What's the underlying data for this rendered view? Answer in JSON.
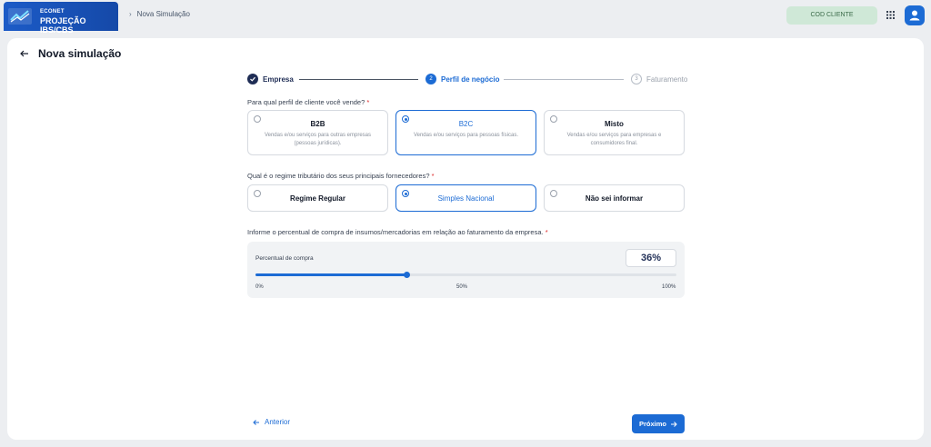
{
  "brand": {
    "subtitle": "ECONET",
    "title": "PROJEÇÃO IBS/CBS"
  },
  "breadcrumb": {
    "current": "Nova Simulação"
  },
  "header": {
    "cod_cliente_label": "COD CLIENTE"
  },
  "page": {
    "title": "Nova simulação"
  },
  "stepper": {
    "steps": [
      {
        "label": "Empresa",
        "number": "",
        "state": "done"
      },
      {
        "label": "Perfil de negócio",
        "number": "2",
        "state": "active"
      },
      {
        "label": "Faturamento",
        "number": "3",
        "state": "pending"
      }
    ]
  },
  "q1": {
    "label": "Para qual perfil de cliente você vende?",
    "required": "*",
    "options": [
      {
        "title": "B2B",
        "desc": "Vendas e/ou serviços para outras empresas (pessoas jurídicas)."
      },
      {
        "title": "B2C",
        "desc": "Vendas e/ou serviços para pessoas físicas."
      },
      {
        "title": "Misto",
        "desc": "Vendas e/ou serviços para empresas e consumidores final."
      }
    ],
    "selected_index": 1
  },
  "q2": {
    "label": "Qual é o regime tributário dos seus principais fornecedores?",
    "required": "*",
    "options": [
      {
        "title": "Regime Regular"
      },
      {
        "title": "Simples Nacional"
      },
      {
        "title": "Não sei informar"
      }
    ],
    "selected_index": 1
  },
  "q3": {
    "label": "Informe o percentual de compra de insumos/mercadorias em relação ao faturamento da empresa.",
    "required": "*",
    "field_label": "Percentual de compra",
    "value_text": "36%",
    "value": 36,
    "ticks": [
      "0%",
      "50%",
      "100%"
    ]
  },
  "nav": {
    "prev_label": "Anterior",
    "next_label": "Próximo"
  },
  "colors": {
    "accent": "#1c6bd4",
    "dark": "#1f2d55",
    "cod_bg": "#cfe8d7"
  }
}
